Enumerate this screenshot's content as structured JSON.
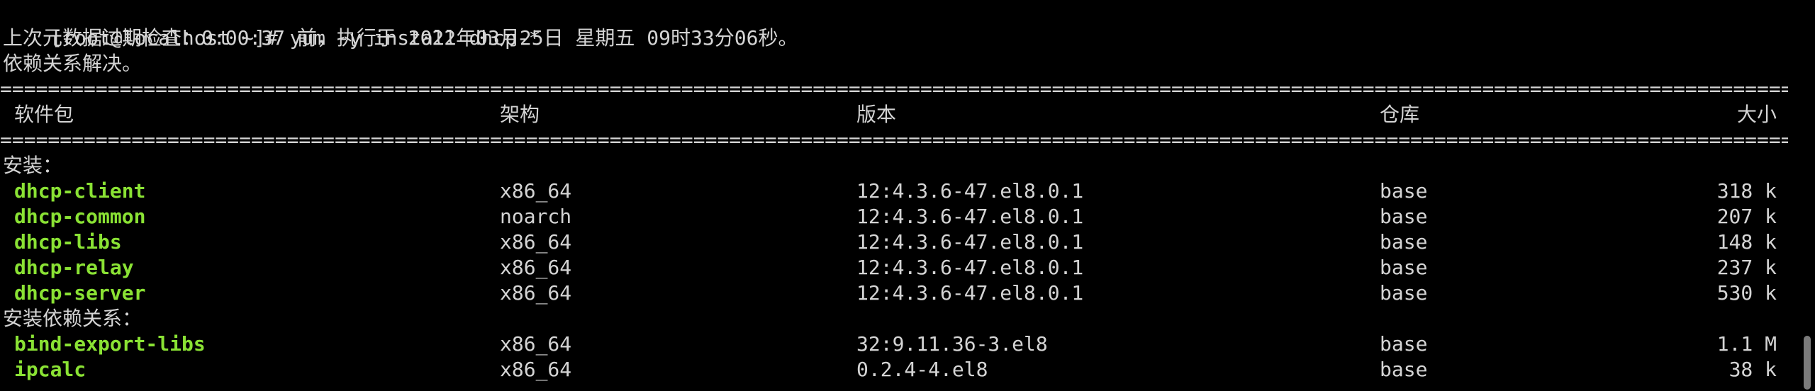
{
  "terminal": {
    "prompt": "[root@localhost ~]# ",
    "command": "yum -y install dhcp-*",
    "metadata_line": "上次元数据过期检查：0:00:37 前，执行于 2022年03月25日 星期五 09时33分06秒。",
    "deps_resolved": "依赖关系解决。",
    "separator": "==========================================================================================================================================================================================================",
    "headers": {
      "package": "软件包",
      "arch": "架构",
      "version": "版本",
      "repo": "仓库",
      "size": "大小"
    },
    "sections": [
      {
        "title": "安装：",
        "rows": [
          {
            "package": "dhcp-client",
            "arch": "x86_64",
            "version": "12:4.3.6-47.el8.0.1",
            "repo": "base",
            "size": "318 k"
          },
          {
            "package": "dhcp-common",
            "arch": "noarch",
            "version": "12:4.3.6-47.el8.0.1",
            "repo": "base",
            "size": "207 k"
          },
          {
            "package": "dhcp-libs",
            "arch": "x86_64",
            "version": "12:4.3.6-47.el8.0.1",
            "repo": "base",
            "size": "148 k"
          },
          {
            "package": "dhcp-relay",
            "arch": "x86_64",
            "version": "12:4.3.6-47.el8.0.1",
            "repo": "base",
            "size": "237 k"
          },
          {
            "package": "dhcp-server",
            "arch": "x86_64",
            "version": "12:4.3.6-47.el8.0.1",
            "repo": "base",
            "size": "530 k"
          }
        ]
      },
      {
        "title": "安装依赖关系：",
        "rows": [
          {
            "package": "bind-export-libs",
            "arch": "x86_64",
            "version": "32:9.11.36-3.el8",
            "repo": "base",
            "size": "1.1 M"
          },
          {
            "package": "ipcalc",
            "arch": "x86_64",
            "version": "0.2.4-4.el8",
            "repo": "base",
            "size": "38 k"
          }
        ]
      }
    ]
  },
  "colors": {
    "background": "#000000",
    "text": "#d4d4d4",
    "package_name": "#8ae234",
    "scrollbar_thumb": "#7b7b7b"
  }
}
